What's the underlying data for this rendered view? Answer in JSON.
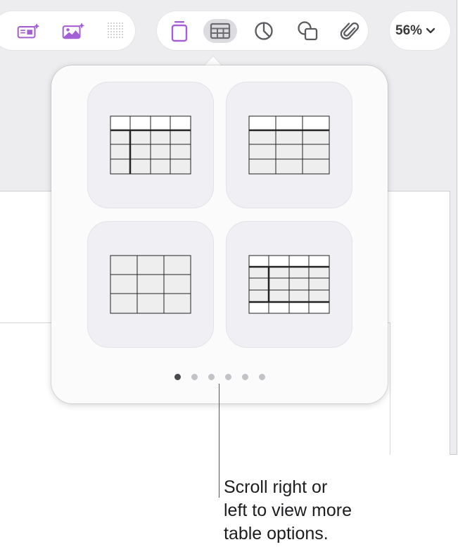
{
  "toolbar": {
    "left_tools": [
      {
        "name": "text-box-tool",
        "icon": "text-box-sparkle-icon"
      },
      {
        "name": "media-tool",
        "icon": "image-sparkle-icon"
      },
      {
        "name": "grid-tool",
        "icon": "dot-grid-icon"
      }
    ],
    "middle_tools": [
      {
        "name": "text-tool",
        "icon": "text-box-icon"
      },
      {
        "name": "table-tool",
        "icon": "table-icon",
        "selected": true
      },
      {
        "name": "chart-tool",
        "icon": "pie-chart-icon"
      },
      {
        "name": "shape-tool",
        "icon": "shapes-icon"
      },
      {
        "name": "attachment-tool",
        "icon": "paperclip-icon"
      }
    ],
    "zoom_label": "56%",
    "accent_color": "#a45fd4"
  },
  "table_popover": {
    "styles": [
      "header-row-and-column",
      "header-row",
      "plain",
      "header-row-footer-column"
    ],
    "page_count": 6,
    "current_page": 1
  },
  "callout": {
    "line1": "Scroll right or",
    "line2": "left to view more",
    "line3": "table options."
  }
}
